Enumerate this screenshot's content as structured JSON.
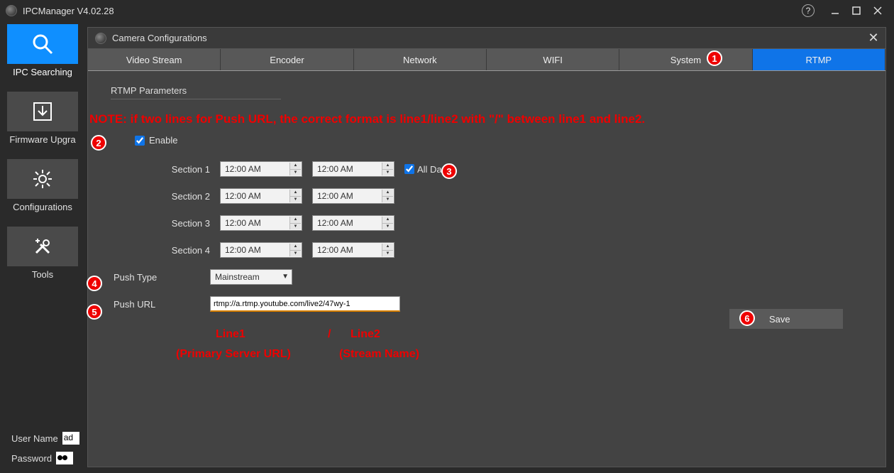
{
  "app": {
    "title": "IPCManager V4.02.28"
  },
  "sidebar": {
    "items": [
      {
        "label": "IPC Searching"
      },
      {
        "label": "Firmware Upgra"
      },
      {
        "label": "Configurations"
      },
      {
        "label": "Tools"
      }
    ],
    "username_label": "User Name",
    "username_value": "ad",
    "password_label": "Password"
  },
  "panel": {
    "title": "Camera Configurations",
    "tabs": [
      "Video Stream",
      "Encoder",
      "Network",
      "WIFI",
      "System",
      "RTMP"
    ],
    "active_tab": "RTMP"
  },
  "rtmp": {
    "section_title": "RTMP Parameters",
    "enable_label": "Enable",
    "enable_checked": true,
    "sections": [
      {
        "label": "Section 1",
        "from": "12:00 AM",
        "to": "12:00 AM"
      },
      {
        "label": "Section 2",
        "from": "12:00 AM",
        "to": "12:00 AM"
      },
      {
        "label": "Section 3",
        "from": "12:00 AM",
        "to": "12:00 AM"
      },
      {
        "label": "Section 4",
        "from": "12:00 AM",
        "to": "12:00 AM"
      }
    ],
    "all_day_label": "All Day",
    "all_day_checked": true,
    "push_type_label": "Push Type",
    "push_type_value": "Mainstream",
    "push_url_label": "Push URL",
    "push_url_value": "rtmp://a.rtmp.youtube.com/live2/47wy-1",
    "save_label": "Save"
  },
  "annotations": {
    "note": "NOTE: if two lines for Push URL, the correct format is line1/line2 with \"/\" between line1 and line2.",
    "line1": "Line1",
    "slash": "/",
    "line2": "Line2",
    "primary": "(Primary Server URL)",
    "stream": "(Stream Name)"
  }
}
